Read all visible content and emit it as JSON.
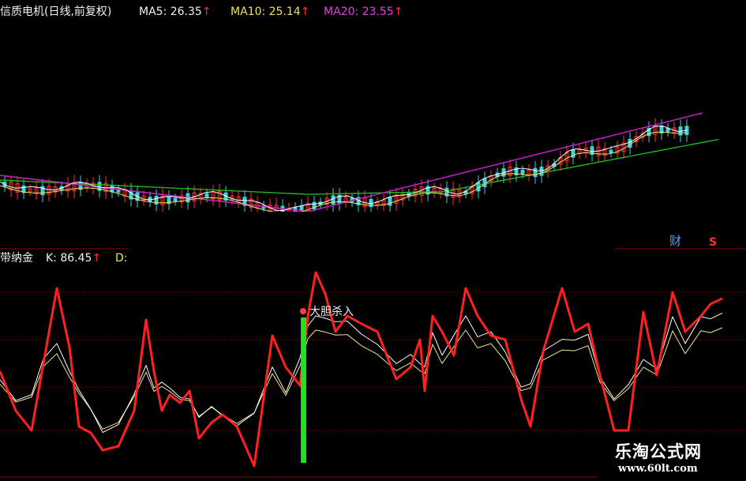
{
  "upper_panel": {
    "stock_title": "信质电机(日线,前复权)",
    "ma_items": [
      {
        "label": "MA5: 26.35",
        "arrow": "↑",
        "color": "#f0f0f0"
      },
      {
        "label": "MA10: 25.14",
        "arrow": "↑",
        "color": "#f0e060"
      },
      {
        "label": "MA20: 23.55",
        "arrow": "↑",
        "color": "#e040e0"
      }
    ],
    "corner_text": "财",
    "corner_badge": "S"
  },
  "lower_panel": {
    "indicator_name": "带纳金",
    "k_label": "K: 86.45",
    "k_arrow": "↑",
    "d_label": "D:",
    "signal_text": "大胆杀入"
  },
  "watermark": {
    "title": "乐淘公式网",
    "url": "www.60lt.com"
  },
  "colors": {
    "background": "#000000",
    "grid": "#8b0000",
    "k_line": "#ff2020",
    "d_line": "#ffffff",
    "j_line": "#f0e68c",
    "ma60_line": "#20c020",
    "ma20_line": "#c020c0",
    "signal_bar": "#20e020"
  },
  "chart_data": [
    {
      "type": "line",
      "series": [
        {
          "name": "MA20",
          "values": [
            23.55
          ]
        }
      ]
    },
    {
      "type": "line",
      "series": [
        {
          "name": "K",
          "values": [
            86.45
          ]
        }
      ]
    }
  ]
}
